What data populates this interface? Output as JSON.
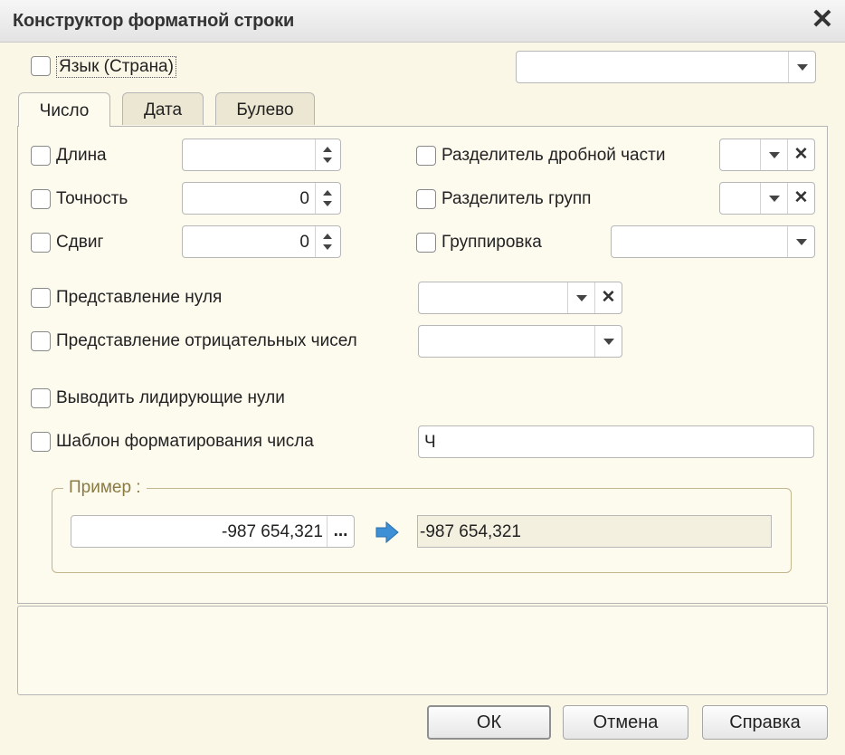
{
  "window": {
    "title": "Конструктор форматной строки",
    "close_icon": "close-icon"
  },
  "language": {
    "label": "Язык (Страна)",
    "value": ""
  },
  "tabs": [
    {
      "label": "Число",
      "active": true
    },
    {
      "label": "Дата",
      "active": false
    },
    {
      "label": "Булево",
      "active": false
    }
  ],
  "number_tab": {
    "length": {
      "label": "Длина",
      "value": ""
    },
    "precision": {
      "label": "Точность",
      "value": "0"
    },
    "shift": {
      "label": "Сдвиг",
      "value": "0"
    },
    "decimal_separator": {
      "label": "Разделитель дробной части",
      "value": ""
    },
    "group_separator": {
      "label": "Разделитель групп",
      "value": ""
    },
    "grouping": {
      "label": "Группировка",
      "value": ""
    },
    "zero_representation": {
      "label": "Представление нуля",
      "value": ""
    },
    "negative_representation": {
      "label": "Представление отрицательных чисел",
      "value": ""
    },
    "leading_zeros": {
      "label": "Выводить лидирующие нули"
    },
    "template": {
      "label": "Шаблон форматирования числа",
      "value": "Ч"
    }
  },
  "example": {
    "label": "Пример :",
    "input_value": "-987 654,321",
    "browse_label": "...",
    "output_value": "-987 654,321",
    "arrow_color": "#3d8fd6"
  },
  "buttons": {
    "ok": "ОК",
    "cancel": "Отмена",
    "help": "Справка"
  },
  "colors": {
    "background": "#fbf7e6",
    "panel": "#fdfaee"
  }
}
